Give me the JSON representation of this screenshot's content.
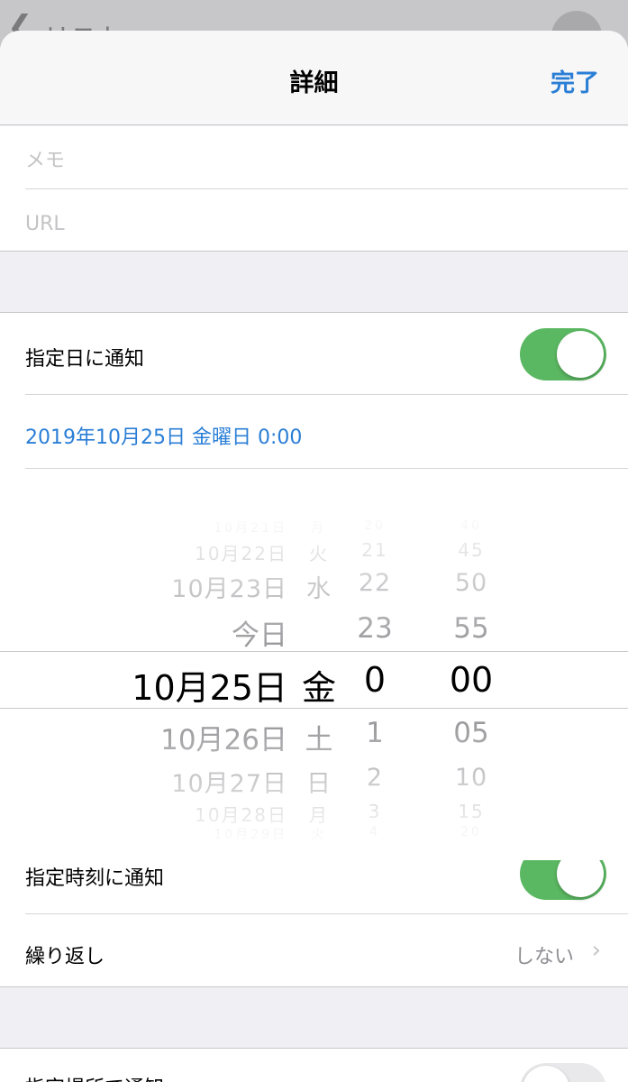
{
  "background": {
    "back_arrow": "❮",
    "back_label": "リスト"
  },
  "header": {
    "title": "詳細",
    "done_label": "完了"
  },
  "notes": {
    "memo_placeholder": "メモ",
    "url_placeholder": "URL"
  },
  "date_alarm": {
    "label": "指定日に通知",
    "enabled": true,
    "selected_date_text": "2019年10月25日 金曜日 0:00"
  },
  "picker": {
    "rows": [
      {
        "date": "10月21日",
        "day": "月",
        "hour": "20",
        "minute": "40"
      },
      {
        "date": "10月22日",
        "day": "火",
        "hour": "21",
        "minute": "45"
      },
      {
        "date": "10月23日",
        "day": "水",
        "hour": "22",
        "minute": "50"
      },
      {
        "date": "今日",
        "day": "",
        "hour": "23",
        "minute": "55"
      },
      {
        "date": "10月25日",
        "day": "金",
        "hour": "0",
        "minute": "00"
      },
      {
        "date": "10月26日",
        "day": "土",
        "hour": "1",
        "minute": "05"
      },
      {
        "date": "10月27日",
        "day": "日",
        "hour": "2",
        "minute": "10"
      },
      {
        "date": "10月28日",
        "day": "月",
        "hour": "3",
        "minute": "15"
      },
      {
        "date": "10月29日",
        "day": "火",
        "hour": "4",
        "minute": "20"
      }
    ],
    "selected_index": 4
  },
  "time_alarm": {
    "label": "指定時刻に通知",
    "enabled": true
  },
  "repeat": {
    "label": "繰り返し",
    "value": "しない",
    "chevron": "›"
  },
  "location_alarm": {
    "label": "指定場所で通知",
    "enabled": false
  },
  "colors": {
    "accent": "#2a7ed6",
    "toggle_on": "#5bb862",
    "background": "#efeff4"
  }
}
